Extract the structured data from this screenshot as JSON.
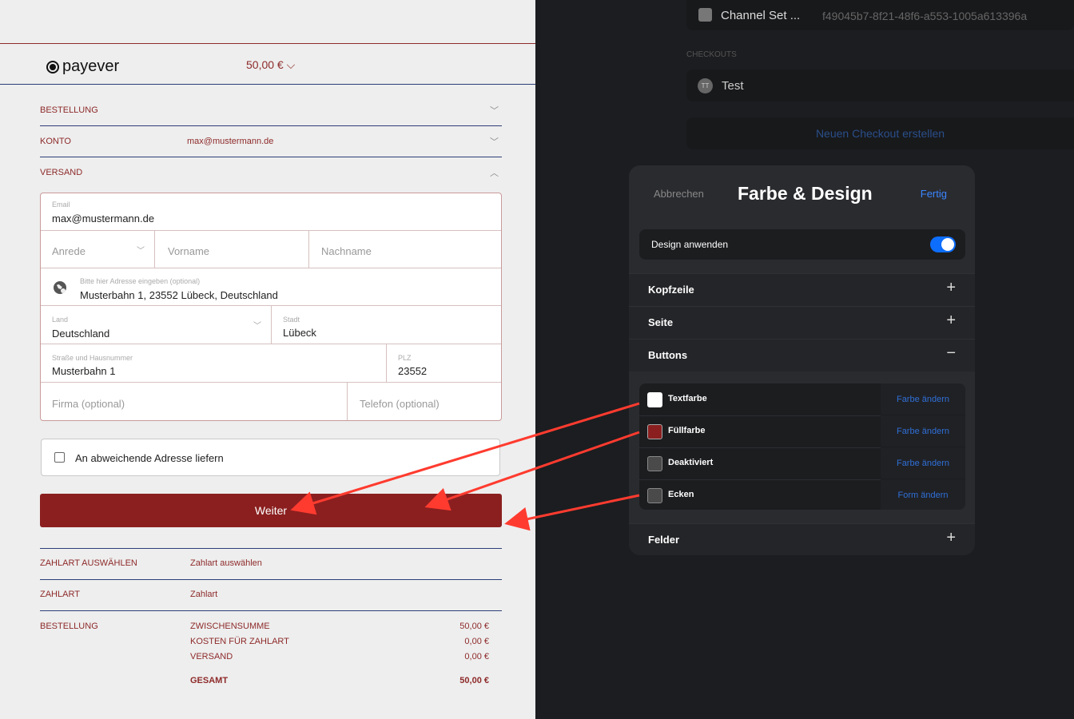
{
  "checkout": {
    "logo_text": "payever",
    "amount": "50,00 € ⌵",
    "rows": {
      "bestellung": "BESTELLUNG",
      "konto": "KONTO",
      "konto_value": "max@mustermann.de",
      "versand": "VERSAND"
    },
    "form": {
      "email_label": "Email",
      "email_value": "max@mustermann.de",
      "anrede_placeholder": "Anrede",
      "vorname_placeholder": "Vorname",
      "nachname_placeholder": "Nachname",
      "address_label": "Bitte hier Adresse eingeben (optional)",
      "address_value": "Musterbahn 1, 23552 Lübeck, Deutschland",
      "land_label": "Land",
      "land_value": "Deutschland",
      "stadt_label": "Stadt",
      "stadt_value": "Lübeck",
      "strasse_label": "Straße und Hausnummer",
      "strasse_value": "Musterbahn 1",
      "plz_label": "PLZ",
      "plz_value": "23552",
      "firma_placeholder": "Firma (optional)",
      "telefon_placeholder": "Telefon (optional)"
    },
    "alt_address_label": "An abweichende Adresse liefern",
    "weiter_button": "Weiter",
    "zahlart_auswaehlen": "ZAHLART AUSWÄHLEN",
    "zahlart_auswaehlen_value": "Zahlart auswählen",
    "zahlart": "ZAHLART",
    "zahlart_value": "Zahlart",
    "bestellung": "BESTELLUNG",
    "summary": {
      "zwischensumme": "ZWISCHENSUMME",
      "zwischensumme_value": "50,00 €",
      "kosten": "KOSTEN FÜR ZAHLART",
      "kosten_value": "0,00 €",
      "versand": "VERSAND",
      "versand_value": "0,00 €",
      "gesamt": "GESAMT",
      "gesamt_value": "50,00 €"
    }
  },
  "background": {
    "channel_set": "Channel Set ...",
    "channel_id": "f49045b7-8f21-48f6-a553-1005a613396a",
    "checkouts_label": "CHECKOUTS",
    "checkout_avatar": "TT",
    "checkout_name": "Test",
    "new_checkout": "Neuen Checkout erstellen"
  },
  "panel": {
    "cancel": "Abbrechen",
    "title": "Farbe & Design",
    "done": "Fertig",
    "apply_design": "Design anwenden",
    "sections": {
      "kopfzeile": "Kopfzeile",
      "seite": "Seite",
      "buttons": "Buttons",
      "felder": "Felder"
    },
    "plus": "+",
    "minus": "−",
    "button_settings": [
      {
        "label": "Textfarbe",
        "action": "Farbe ändern",
        "color": "#ffffff"
      },
      {
        "label": "Füllfarbe",
        "action": "Farbe ändern",
        "color": "#8b1f1f"
      },
      {
        "label": "Deaktiviert",
        "action": "Farbe ändern",
        "color": "#4a4a4a"
      },
      {
        "label": "Ecken",
        "action": "Form ändern",
        "color": "#4a4a4a"
      }
    ]
  },
  "colors": {
    "accent_red": "#8b1f1f",
    "link_blue": "#2f6fd6",
    "toggle_blue": "#0d6efd",
    "arrow_red": "#ff3b2f"
  }
}
